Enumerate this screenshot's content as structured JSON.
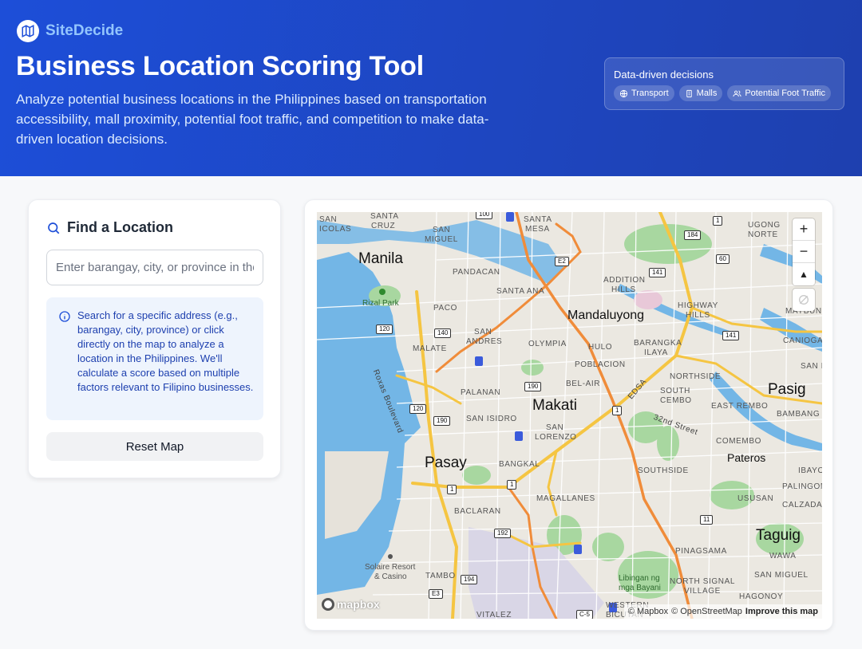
{
  "brand": {
    "name": "SiteDecide"
  },
  "hero": {
    "title": "Business Location Scoring Tool",
    "description": "Analyze potential business locations in the Philippines based on transportation accessibility, mall proximity, potential foot traffic, and competition to make data-driven location decisions."
  },
  "badge": {
    "title": "Data-driven decisions",
    "chips": [
      {
        "label": "Transport",
        "icon": "globe-icon"
      },
      {
        "label": "Malls",
        "icon": "building-icon"
      },
      {
        "label": "Potential Foot Traffic",
        "icon": "users-icon"
      }
    ]
  },
  "finder": {
    "title": "Find a Location",
    "search_placeholder": "Enter barangay, city, or province in the Philippines",
    "search_value": "",
    "info": "Search for a specific address (e.g., barangay, city, province) or click directly on the map to analyze a location in the Philippines. We'll calculate a score based on multiple factors relevant to Filipino businesses.",
    "reset_label": "Reset Map"
  },
  "map": {
    "labels_big": [
      "Manila",
      "Makati",
      "Pasay",
      "Mandaluyong",
      "Pasig",
      "Taguig",
      "Pateros"
    ],
    "labels_small": [
      "SAN",
      "ICOLAS",
      "SANTA",
      "CRUZ",
      "SAN",
      "MIGUEL",
      "SANTA",
      "MESA",
      "PANDACAN",
      "SANTA ANA",
      "ADDITION",
      "HILLS",
      "HIGHWAY",
      "HILLS",
      "UGONG",
      "NORTE",
      "PACO",
      "SAN",
      "ANDRES",
      "MALATE",
      "OLYMPIA",
      "HULO",
      "BARANGKA",
      "ILAYA",
      "POBLACION",
      "PALANAN",
      "BEL-AIR",
      "SOUTH",
      "CEMBO",
      "NORTHSIDE",
      "EAST REMBO",
      "SAN ISIDRO",
      "SAN",
      "LORENZO",
      "BANGKAL",
      "COMEMBO",
      "SOUTHSIDE",
      "MAGALLANES",
      "BACLARAN",
      "USUSAN",
      "PALINGON",
      "CALZADA",
      "PINAGSAMA",
      "NORTH SIGNAL",
      "VILLAGE",
      "WAWA",
      "SAN MIGUEL",
      "HAGONOY",
      "VITALEZ",
      "WESTERN",
      "BICUTAN",
      "TAMBO",
      "CANIOGAN",
      "SAN N",
      "BAMBANG",
      "MAYBUN",
      "IBAYO"
    ],
    "parks": [
      "Rizal Park",
      "Libingan ng",
      "mga Bayani",
      "Solaire Resort",
      "& Casino"
    ],
    "roads": [
      "Roxas Boulevard",
      "EDSA",
      "32nd Street"
    ],
    "shields": [
      "E2",
      "141",
      "184",
      "60",
      "1",
      "120",
      "140",
      "190",
      "120",
      "190",
      "1",
      "1",
      "1",
      "192",
      "194",
      "E3",
      "11",
      "141",
      "C-5",
      "100"
    ],
    "controls": {
      "zoom_in": "+",
      "zoom_out": "−",
      "compass": "▲"
    },
    "logo": "mapbox",
    "attribution": {
      "mapbox": "© Mapbox",
      "osm": "© OpenStreetMap",
      "improve": "Improve this map"
    }
  }
}
